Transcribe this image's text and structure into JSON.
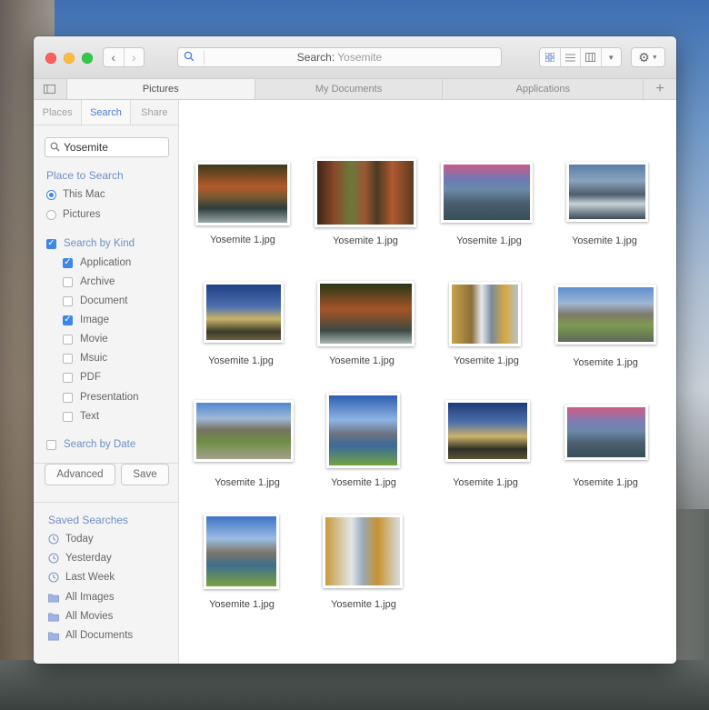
{
  "window": {
    "search_label": "Search:",
    "search_value": "Yosemite"
  },
  "tabs": [
    {
      "label": "Pictures",
      "active": true
    },
    {
      "label": "My Documents",
      "active": false
    },
    {
      "label": "Applications",
      "active": false
    }
  ],
  "sidebar": {
    "segments": [
      "Places",
      "Search",
      "Share"
    ],
    "active_segment": "Search",
    "search_field_value": "Yosemite",
    "place_heading": "Place to Search",
    "places": [
      {
        "label": "This Mac",
        "selected": true
      },
      {
        "label": "Pictures",
        "selected": false
      }
    ],
    "kind_label": "Search by Kind",
    "kind_checked": true,
    "kinds": [
      {
        "label": "Application",
        "checked": true
      },
      {
        "label": "Archive",
        "checked": false
      },
      {
        "label": "Document",
        "checked": false
      },
      {
        "label": "Image",
        "checked": true
      },
      {
        "label": "Movie",
        "checked": false
      },
      {
        "label": "Msuic",
        "checked": false
      },
      {
        "label": "PDF",
        "checked": false
      },
      {
        "label": "Presentation",
        "checked": false
      },
      {
        "label": "Text",
        "checked": false
      }
    ],
    "date_label": "Search by Date",
    "date_checked": false,
    "advanced_label": "Advanced",
    "save_label": "Save",
    "saved_heading": "Saved Searches",
    "saved": [
      {
        "label": "Today",
        "icon": "clock-icon"
      },
      {
        "label": "Yesterday",
        "icon": "clock-icon"
      },
      {
        "label": "Last Week",
        "icon": "clock-icon"
      },
      {
        "label": "All Images",
        "icon": "folder-icon"
      },
      {
        "label": "All Movies",
        "icon": "folder-icon"
      },
      {
        "label": "All Documents",
        "icon": "folder-icon"
      }
    ]
  },
  "files": [
    {
      "name": "Yosemite 1.jpg"
    },
    {
      "name": "Yosemite 1.jpg"
    },
    {
      "name": "Yosemite 1.jpg"
    },
    {
      "name": "Yosemite 1.jpg"
    },
    {
      "name": "Yosemite 1.jpg"
    },
    {
      "name": "Yosemite 1.jpg"
    },
    {
      "name": "Yosemite 1.jpg"
    },
    {
      "name": "Yosemite 1.jpg"
    },
    {
      "name": "Yosemite 1.jpg"
    },
    {
      "name": "Yosemite 1.jpg"
    },
    {
      "name": "Yosemite 1.jpg"
    },
    {
      "name": "Yosemite 1.jpg"
    },
    {
      "name": "Yosemite 1.jpg"
    },
    {
      "name": "Yosemite 1.jpg"
    }
  ],
  "colors": {
    "accent": "#3d86e8",
    "section_heading": "#6c8fc6"
  }
}
